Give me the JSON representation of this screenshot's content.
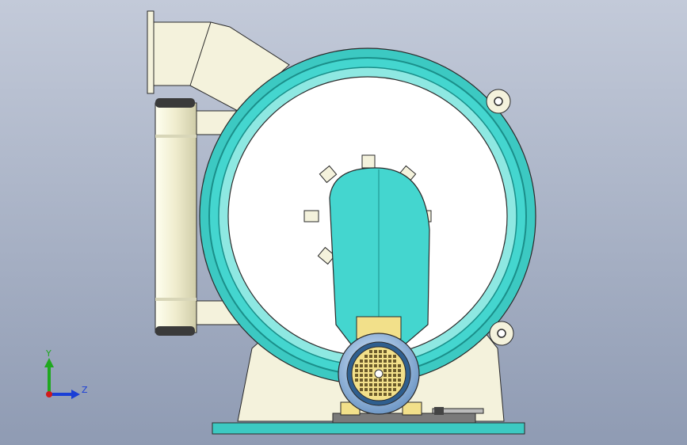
{
  "viewport": {
    "background_top": "#c3cad9",
    "background_bottom": "#8f9bb3"
  },
  "colors": {
    "body_cream": "#f4f2dc",
    "body_shadow": "#d8d6b8",
    "ring_teal": "#44d6cf",
    "ring_dark": "#1a8f8a",
    "drum_white": "#ffffff",
    "outline": "#2a2a2a",
    "motor_blue": "#9ec4e8",
    "fan_yellow": "#f2e08a",
    "fan_grid": "#6b5a2a",
    "base_teal": "#3cc9c2"
  },
  "axis_triad": {
    "y_label": "Y",
    "z_label": "Z",
    "y_color": "#1fa81f",
    "z_color": "#1a3fd6",
    "x_color": "#d21a1a"
  }
}
